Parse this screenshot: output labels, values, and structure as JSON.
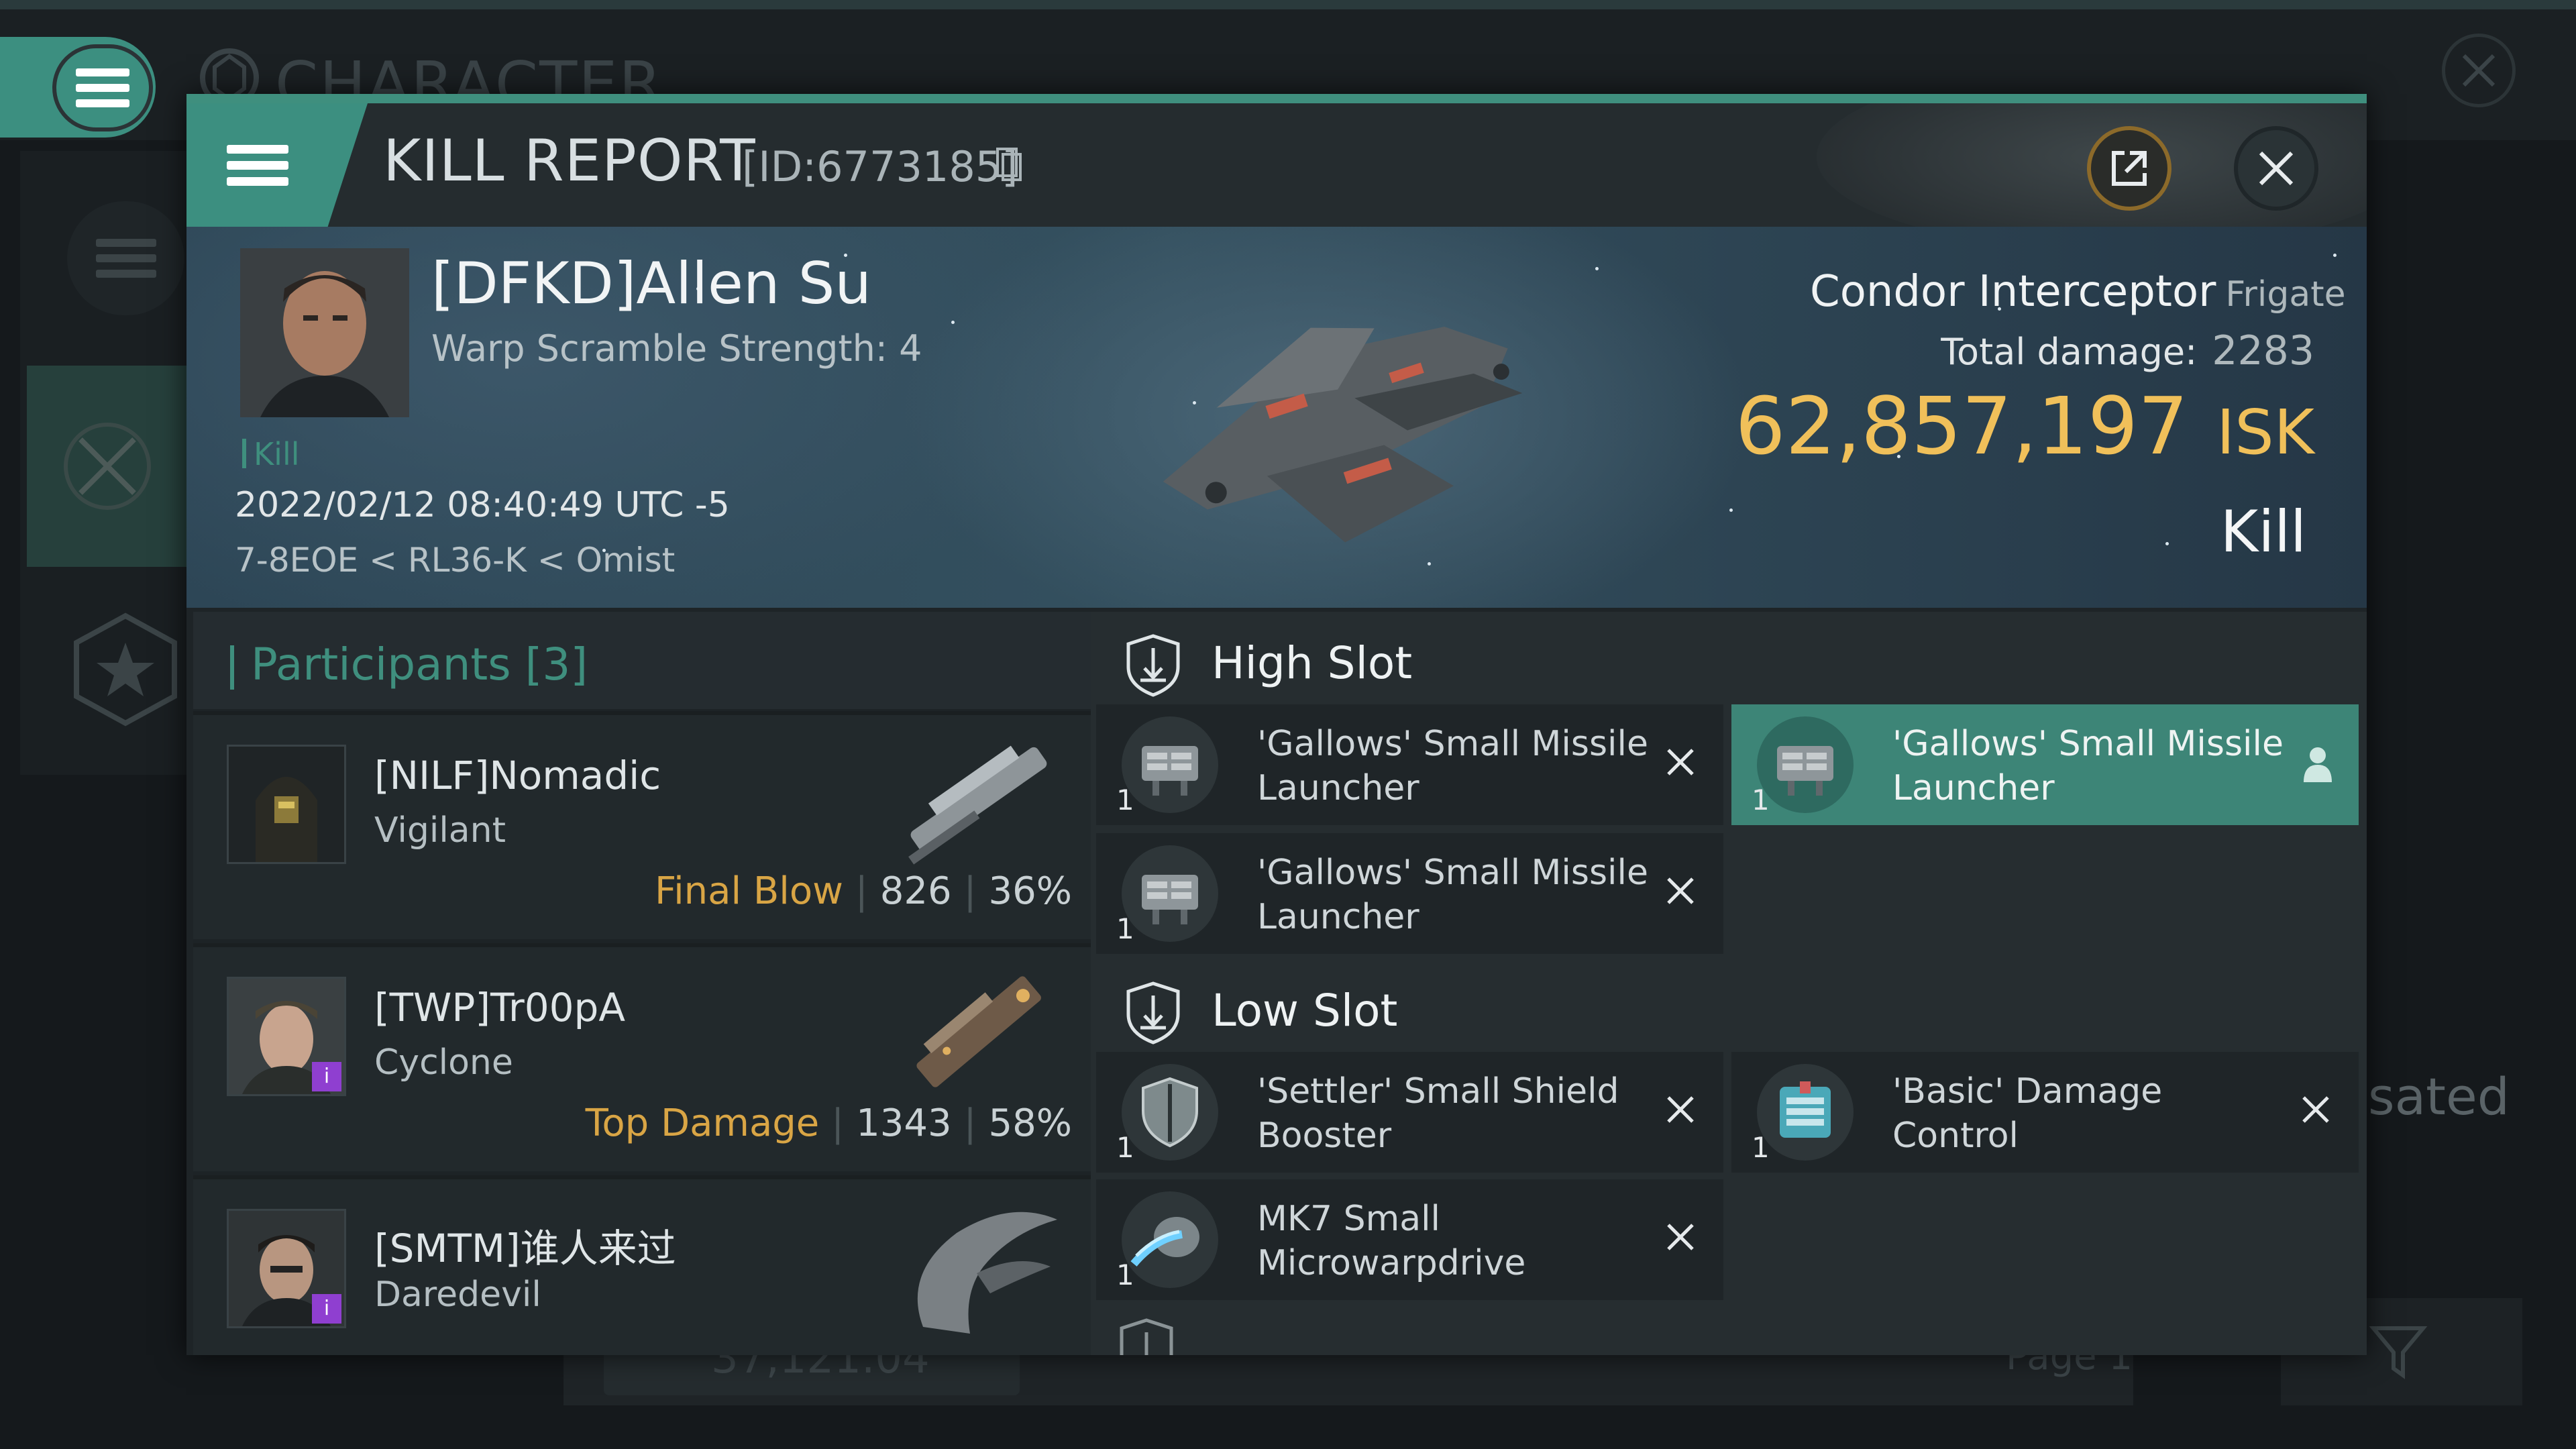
{
  "background": {
    "title": "CHARACTER",
    "compensated_text": "sated",
    "isk_text": "37,121.04",
    "page_text": "Page 1"
  },
  "report": {
    "title": "KILL REPORT",
    "id_text": "[ID:6773185]",
    "share_icon": "share-icon",
    "close_icon": "close-icon",
    "copy_icon": "copy-icon"
  },
  "victim": {
    "name": "[DFKD]Allen Su",
    "warp_scramble": "Warp Scramble Strength: 4",
    "tag": "Kill",
    "time": "2022/02/12 08:40:49 UTC -5",
    "location": "7-8EOE < RL36-K < Omist",
    "ship_name": "Condor Interceptor",
    "ship_class": "Frigate",
    "total_damage_label": "Total damage:",
    "total_damage_value": "2283",
    "isk_value": "62,857,197",
    "isk_currency": "ISK",
    "result": "Kill"
  },
  "participants": {
    "label": "Participants [3]",
    "rows": [
      {
        "name": "[NILF]Nomadic",
        "ship": "Vigilant",
        "tag": "Final Blow",
        "damage": "826",
        "percent": "36%",
        "badge": ""
      },
      {
        "name": "[TWP]Tr00pA",
        "ship": "Cyclone",
        "tag": "Top Damage",
        "damage": "1343",
        "percent": "58%",
        "badge": "i"
      },
      {
        "name": "[SMTM]谁人来过",
        "ship": "Daredevil",
        "tag": "",
        "damage": "",
        "percent": "",
        "badge": "i"
      }
    ]
  },
  "fittings": {
    "high_slot": {
      "label": "High Slot",
      "modules": [
        {
          "name": "'Gallows' Small Missile Launcher",
          "qty": "1",
          "state": "destroyed"
        },
        {
          "name": "'Gallows' Small Missile Launcher",
          "qty": "1",
          "state": "dropped"
        },
        {
          "name": "'Gallows' Small Missile Launcher",
          "qty": "1",
          "state": "destroyed"
        }
      ]
    },
    "low_slot": {
      "label": "Low Slot",
      "modules": [
        {
          "name": "'Settler' Small Shield Booster",
          "qty": "1",
          "state": "destroyed"
        },
        {
          "name": "'Basic' Damage Control",
          "qty": "1",
          "state": "destroyed"
        },
        {
          "name": "MK7 Small Microwarpdrive",
          "qty": "1",
          "state": "destroyed"
        }
      ]
    }
  },
  "colors": {
    "accent_teal": "#3f8f7e",
    "isk_gold": "#f0c05a",
    "tag_gold": "#d9a545",
    "badge_purple": "#8f3fd0"
  }
}
